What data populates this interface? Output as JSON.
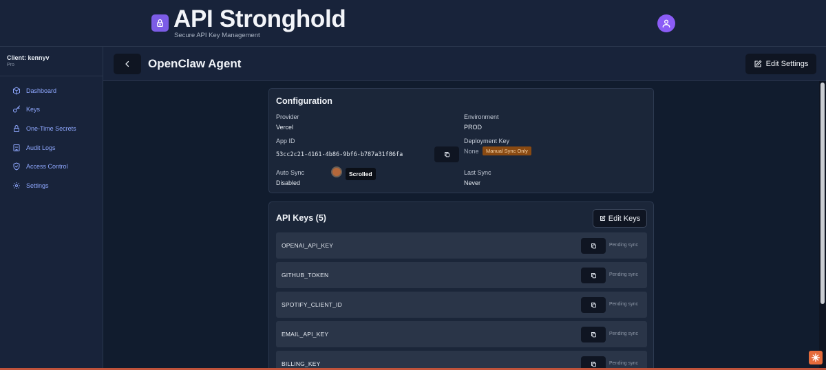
{
  "app": {
    "title": "API Stronghold",
    "subtitle": "Secure API Key Management"
  },
  "client": {
    "label": "Client: kennyv",
    "plan": "Pro"
  },
  "sidebar": {
    "items": [
      {
        "label": "Dashboard",
        "icon": "cube-icon"
      },
      {
        "label": "Keys",
        "icon": "key-icon"
      },
      {
        "label": "One-Time Secrets",
        "icon": "lock-icon"
      },
      {
        "label": "Audit Logs",
        "icon": "building-icon"
      },
      {
        "label": "Access Control",
        "icon": "shield-icon"
      },
      {
        "label": "Settings",
        "icon": "gear-icon"
      }
    ]
  },
  "topbar": {
    "page_title": "OpenClaw Agent",
    "edit_settings_label": "Edit Settings"
  },
  "configuration": {
    "title": "Configuration",
    "provider_label": "Provider",
    "provider_value": "Vercel",
    "environment_label": "Environment",
    "environment_value": "PROD",
    "app_id_label": "App ID",
    "app_id_value": "53cc2c21-4161-4b86-9bf6-b787a31f86fa",
    "deployment_key_label": "Deployment Key",
    "deployment_key_value": "None",
    "deployment_key_badge": "Manual Sync Only",
    "auto_sync_label": "Auto Sync",
    "auto_sync_value": "Disabled",
    "tooltip": "Scrolled",
    "last_sync_label": "Last Sync",
    "last_sync_value": "Never"
  },
  "api_keys": {
    "title": "API Keys (5)",
    "edit_label": "Edit Keys",
    "rows": [
      {
        "name": "OPENAI_API_KEY",
        "status": "Pending sync"
      },
      {
        "name": "GITHUB_TOKEN",
        "status": "Pending sync"
      },
      {
        "name": "SPOTIFY_CLIENT_ID",
        "status": "Pending sync"
      },
      {
        "name": "EMAIL_API_KEY",
        "status": "Pending sync"
      },
      {
        "name": "BILLING_KEY",
        "status": "Pending sync"
      }
    ]
  },
  "colors": {
    "accent": "#7c5ce6",
    "avatar": "#8b5cf6",
    "nav_link": "#8fa8ff",
    "badge_bg": "#8a4a12"
  }
}
